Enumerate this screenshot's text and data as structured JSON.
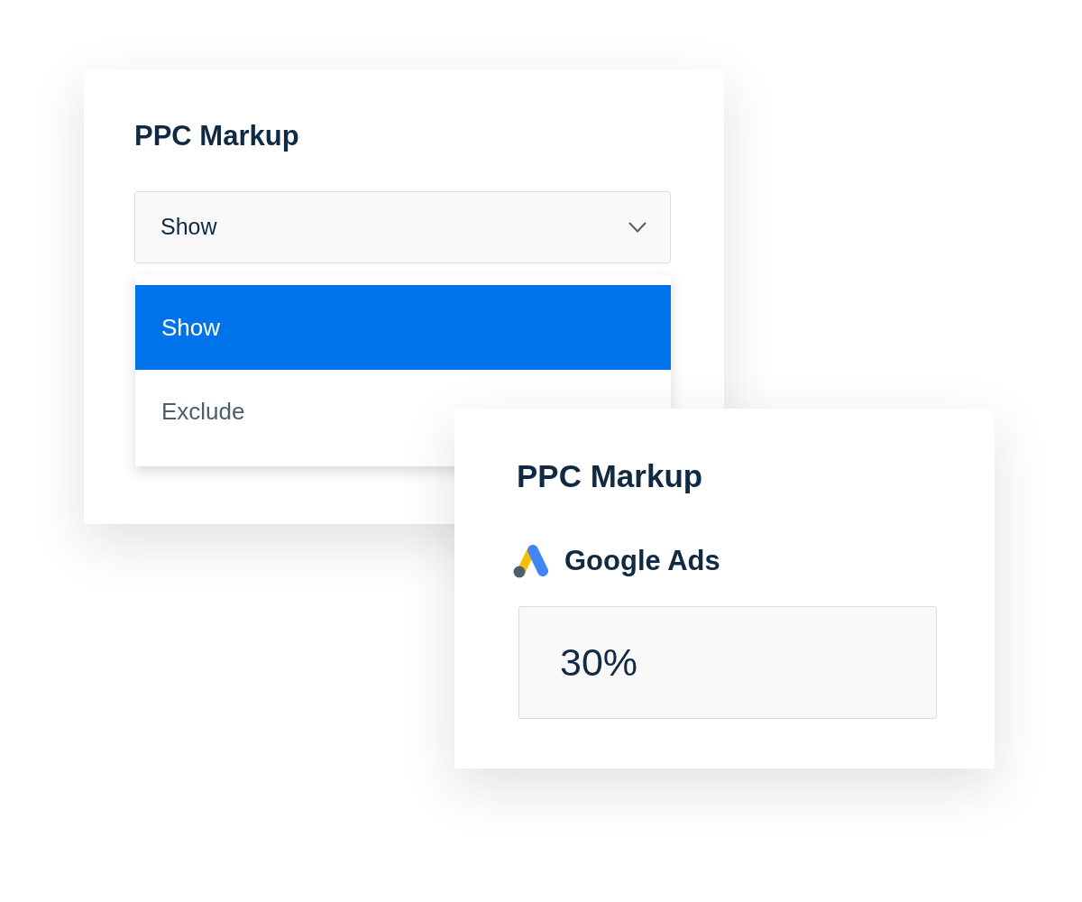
{
  "cards": [
    {
      "kind": "dropdown",
      "title": "PPC Markup",
      "select": {
        "value": "Show",
        "expanded": true
      },
      "options": [
        {
          "label": "Show",
          "selected": true
        },
        {
          "label": "Exclude",
          "selected": false
        }
      ]
    },
    {
      "kind": "input",
      "title": "PPC Markup",
      "platform": "Google Ads",
      "field": {
        "value": "30%"
      }
    }
  ]
}
